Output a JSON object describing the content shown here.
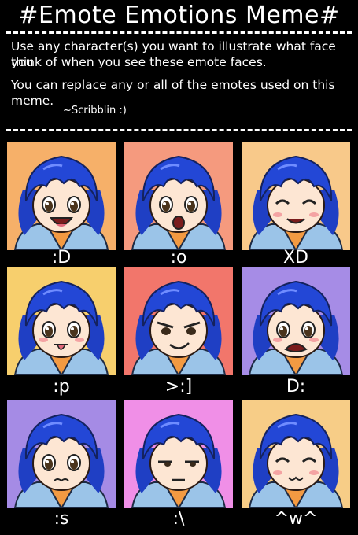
{
  "title": "#Emote Emotions Meme#",
  "intro": {
    "line1": "Use any character(s) you want to illustrate what face you",
    "line2": "think of when you see these emote faces.",
    "line3": "You can replace any or all of the emotes used on this",
    "line4": "meme.",
    "signature": "~Scribblin :)"
  },
  "panels": [
    {
      "caption": ":D",
      "bg": "#f6b069"
    },
    {
      "caption": ":o",
      "bg": "#f59a7e"
    },
    {
      "caption": "XD",
      "bg": "#f8c98a"
    },
    {
      "caption": ":p",
      "bg": "#f7cf6d"
    },
    {
      "caption": ">:]",
      "bg": "#f2766b"
    },
    {
      "caption": "D:",
      "bg": "#a68ce6"
    },
    {
      "caption": ":s",
      "bg": "#a58be5"
    },
    {
      "caption": ":\\",
      "bg": "#f08fe7"
    },
    {
      "caption": "^w^",
      "bg": "#f7cd87"
    }
  ]
}
